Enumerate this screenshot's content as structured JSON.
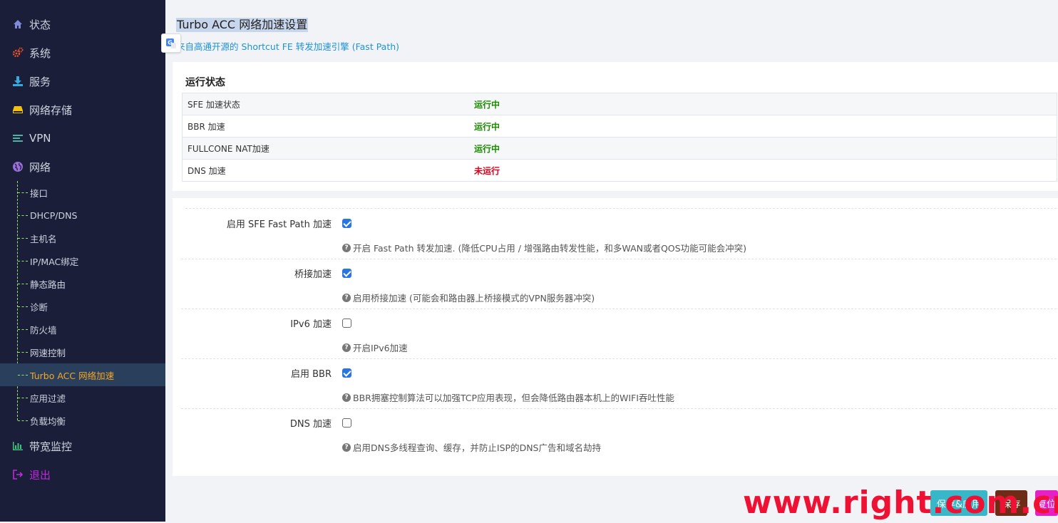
{
  "sidebar": {
    "top_items": [
      {
        "label": "状态",
        "icon": "home-icon"
      },
      {
        "label": "系统",
        "icon": "gears-icon"
      },
      {
        "label": "服务",
        "icon": "download-icon"
      },
      {
        "label": "网络存储",
        "icon": "storage-icon"
      },
      {
        "label": "VPN",
        "icon": "list-icon"
      },
      {
        "label": "网络",
        "icon": "globe-icon"
      }
    ],
    "sub_items": [
      {
        "label": "接口"
      },
      {
        "label": "DHCP/DNS"
      },
      {
        "label": "主机名"
      },
      {
        "label": "IP/MAC绑定"
      },
      {
        "label": "静态路由"
      },
      {
        "label": "诊断"
      },
      {
        "label": "防火墙"
      },
      {
        "label": "网速控制"
      },
      {
        "label": "Turbo ACC 网络加速",
        "active": true
      },
      {
        "label": "应用过滤"
      },
      {
        "label": "负载均衡"
      }
    ],
    "bottom_items": [
      {
        "label": "带宽监控",
        "icon": "bar-chart-icon"
      },
      {
        "label": "退出",
        "icon": "logout-icon"
      }
    ]
  },
  "header": {
    "title": "Turbo ACC 网络加速设置",
    "description": "来自高通开源的 Shortcut FE 转发加速引擎 (Fast Path)"
  },
  "status": {
    "section_title": "运行状态",
    "rows": [
      {
        "label": "SFE 加速状态",
        "value": "运行中",
        "color": "#1a8a00"
      },
      {
        "label": "BBR 加速",
        "value": "运行中",
        "color": "#1a8a00"
      },
      {
        "label": "FULLCONE NAT加速",
        "value": "运行中",
        "color": "#1a8a00"
      },
      {
        "label": "DNS 加速",
        "value": "未运行",
        "color": "#e0001b"
      }
    ]
  },
  "options": [
    {
      "label": "启用 SFE Fast Path 加速",
      "checked": true,
      "help": "开启 Fast Path 转发加速. (降低CPU占用 / 增强路由转发性能，和多WAN或者QOS功能可能会冲突)"
    },
    {
      "label": "桥接加速",
      "checked": true,
      "help": "启用桥接加速 (可能会和路由器上桥接模式的VPN服务器冲突)"
    },
    {
      "label": "IPv6 加速",
      "checked": false,
      "help": "开启IPv6加速"
    },
    {
      "label": "启用 BBR",
      "checked": true,
      "help": "BBR拥塞控制算法可以加强TCP应用表现，但会降低路由器本机上的WIFI吞吐性能"
    },
    {
      "label": "DNS 加速",
      "checked": false,
      "help": "启用DNS多线程查询、缓存，并防止ISP的DNS广告和域名劫持"
    }
  ],
  "buttons": {
    "apply": "保存&应用",
    "save": "保存",
    "reset": "复位"
  },
  "watermark": "www.right.com.cn",
  "colors": {
    "sidebar_bg": "#1a1e39",
    "active_item": "#f6a623",
    "link": "#1e93d6"
  }
}
